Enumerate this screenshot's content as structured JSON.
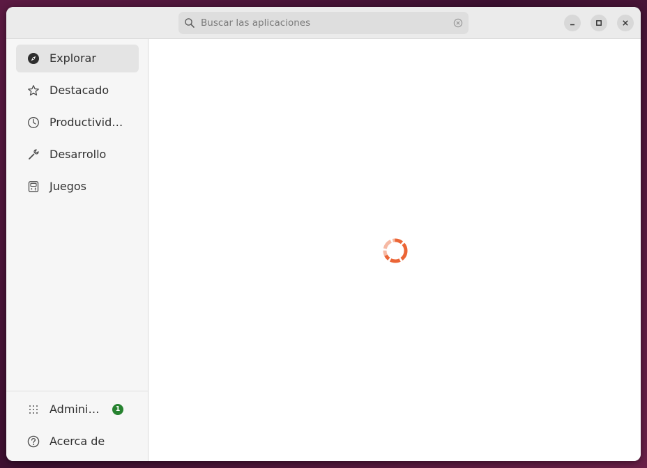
{
  "search": {
    "placeholder": "Buscar las aplicaciones",
    "value": ""
  },
  "window_controls": {
    "minimize_icon": "minimize-icon",
    "maximize_icon": "maximize-icon",
    "close_icon": "close-icon"
  },
  "sidebar": {
    "items": [
      {
        "label": "Explorar",
        "icon": "compass-icon",
        "selected": true
      },
      {
        "label": "Destacado",
        "icon": "star-icon",
        "selected": false
      },
      {
        "label": "Productivid…",
        "icon": "clock-icon",
        "selected": false
      },
      {
        "label": "Desarrollo",
        "icon": "wrench-icon",
        "selected": false
      },
      {
        "label": "Juegos",
        "icon": "game-icon",
        "selected": false
      }
    ],
    "bottom_items": [
      {
        "label": "Admini…",
        "icon": "grid-dots-icon",
        "badge": "1"
      },
      {
        "label": "Acerca de",
        "icon": "help-icon"
      }
    ]
  },
  "content": {
    "state_icon": "loading-spinner-icon"
  },
  "colors": {
    "accent": "#e95420",
    "badge": "#26822f",
    "sidebar_bg": "#f6f6f6",
    "headerbar_bg": "#ebebeb",
    "selected_bg": "#e4e4e4"
  }
}
